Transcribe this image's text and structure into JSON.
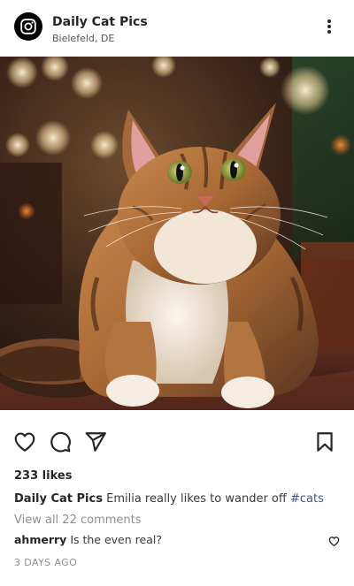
{
  "header": {
    "username": "Daily Cat Pics",
    "location": "Bielefeld, DE",
    "avatar_icon": "instagram-icon",
    "more_icon": "more-vertical-icon"
  },
  "post": {
    "image_subject": "tabby-cat-photo",
    "actions": {
      "like_icon": "heart-icon",
      "comment_icon": "comment-bubble-icon",
      "share_icon": "send-paper-plane-icon",
      "save_icon": "bookmark-icon"
    },
    "likes_text": "233 likes",
    "caption": {
      "username": "Daily Cat Pics",
      "text": "Emilia really likes to wander off",
      "hashtag": "#cats"
    },
    "view_all_comments": "View all 22 comments",
    "comments": [
      {
        "username": "ahmerry",
        "text": "Is the even real?"
      }
    ],
    "timestamp": "3 DAYS AGO"
  },
  "colors": {
    "text": "#262626",
    "muted": "#8e8e8e",
    "hashtag": "#385898"
  }
}
